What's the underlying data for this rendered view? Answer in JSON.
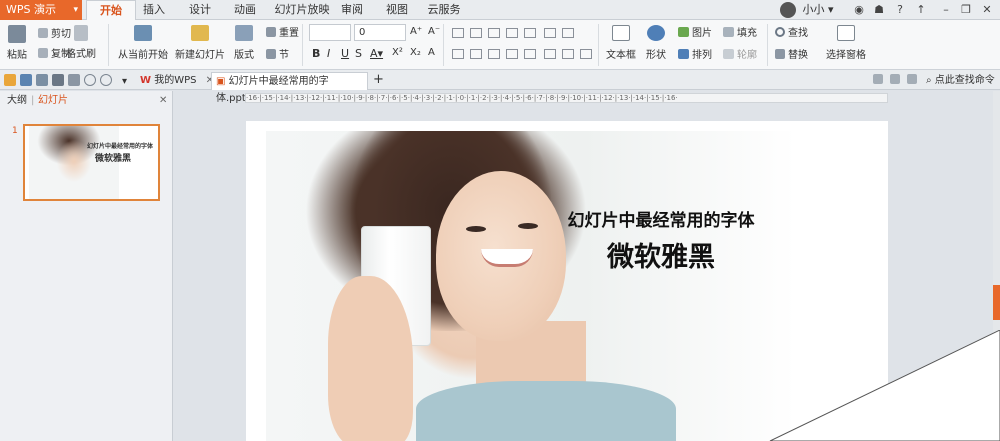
{
  "app": {
    "name": "WPS 演示"
  },
  "menu_tabs": [
    "开始",
    "插入",
    "设计",
    "动画",
    "幻灯片放映",
    "审阅",
    "视图",
    "云服务"
  ],
  "user": {
    "name": "小小"
  },
  "ribbon": {
    "paste": "粘贴",
    "cut": "剪切",
    "copy": "复制",
    "format_painter": "格式刷",
    "from_current": "从当前开始",
    "new_slide": "新建幻灯片",
    "layout": "版式",
    "section": "节",
    "reset": "重置",
    "font_size_value": "0",
    "text_box": "文本框",
    "shape": "形状",
    "picture": "图片",
    "fill": "填充",
    "arrange": "排列",
    "outline": "轮廓",
    "find": "查找",
    "replace": "替换",
    "selection_pane": "选择窗格"
  },
  "doc_tabs": [
    "我的WPS",
    "幻灯片中最经常用的字体.pptx"
  ],
  "search_command": "点此查找命令",
  "panel": {
    "outline_tab": "大纲",
    "slides_tab": "幻灯片",
    "slide_number": "1",
    "thumb_title": "幻灯片中最经常用的字体",
    "thumb_font": "微软雅黑"
  },
  "ruler": "·16·|·15·|·14·|·13·|·12·|·11·|·10·|·9·|·8·|·7·|·6·|·5·|·4·|·3·|·2·|·1·|·0·|·1·|·2·|·3·|·4·|·5·|·6·|·7·|·8·|·9·|·10·|·11·|·12·|·13·|·14·|·15·|·16·",
  "slide": {
    "title": "幻灯片中最经常用的字体",
    "font_name": "微软雅黑"
  },
  "colors": {
    "accent": "#e8682a",
    "active_tab": "#d9541d"
  }
}
